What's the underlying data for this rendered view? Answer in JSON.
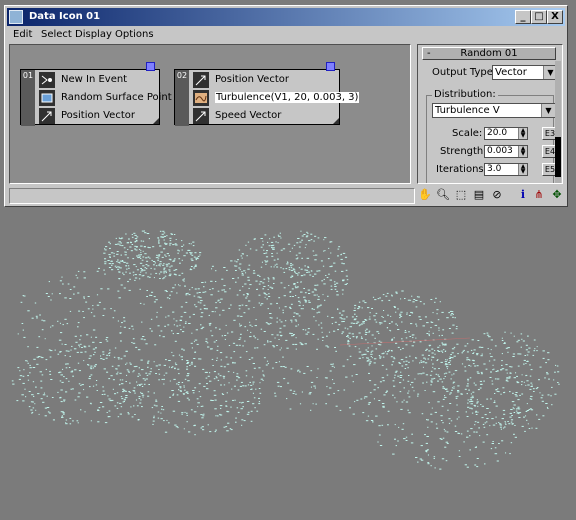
{
  "window": {
    "title": "Data Icon 01",
    "buttons": {
      "minimize": "_",
      "maximize": "□",
      "close": "X"
    }
  },
  "menu": [
    "Edit",
    "Select",
    "Display",
    "Options"
  ],
  "graph": {
    "node1": {
      "number": "01",
      "items": [
        {
          "label": "New In Event",
          "icon": "event-icon"
        },
        {
          "label": "Random Surface Point",
          "icon": "surface-icon"
        },
        {
          "label": "Position Vector",
          "icon": "vector-icon"
        }
      ]
    },
    "node2": {
      "number": "02",
      "items": [
        {
          "label": "Position Vector",
          "icon": "vector-icon"
        },
        {
          "label": "Turbulence(V1, 20, 0.003, 3)",
          "icon": "turbulence-icon"
        },
        {
          "label": "Speed Vector",
          "icon": "vector-icon"
        }
      ]
    }
  },
  "panel": {
    "rollout_title": "Random 01",
    "rollout_toggle": "-",
    "output_type_label": "Output Type:",
    "output_type_value": "Vector",
    "distribution_label": "Distribution:",
    "distribution_value": "Turbulence V",
    "scale_label": "Scale:",
    "scale_value": "20.0",
    "scale_btn": "E3",
    "strength_label": "Strength:",
    "strength_value": "0.003",
    "strength_btn": "E4",
    "iterations_label": "Iterations:",
    "iterations_value": "3.0",
    "iterations_btn": "E5"
  },
  "toolbar_icons": [
    "hand-icon",
    "zoom-icon",
    "zoom-region-icon",
    "zoom-extents-icon",
    "no-icon",
    "info-icon",
    "tree-icon",
    "pan-icon"
  ]
}
